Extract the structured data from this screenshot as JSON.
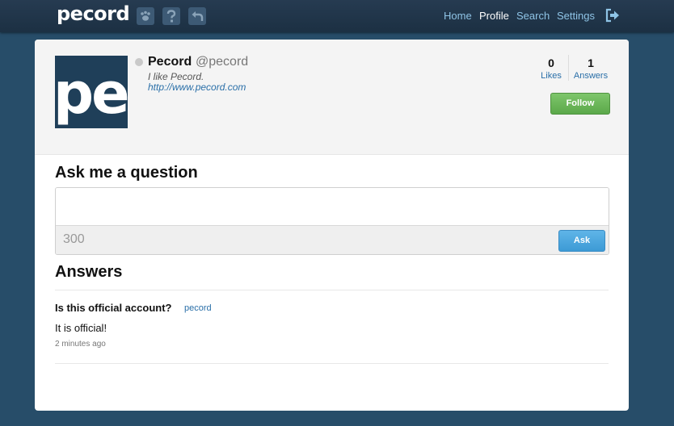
{
  "header": {
    "logo": "pecord",
    "icons": [
      "paw-icon",
      "question-icon",
      "undo-icon"
    ],
    "nav": {
      "home": "Home",
      "profile": "Profile",
      "search": "Search",
      "settings": "Settings"
    },
    "logout_icon": "logout-icon",
    "active_nav": "Profile"
  },
  "profile": {
    "avatar_text": "pe",
    "display_name": "Pecord",
    "handle": "@pecord",
    "bio": "I like Pecord.",
    "website": "http://www.pecord.com",
    "stats": {
      "likes_count": "0",
      "likes_label": "Likes",
      "answers_count": "1",
      "answers_label": "Answers"
    },
    "follow_label": "Follow"
  },
  "ask": {
    "title": "Ask me a question",
    "input_value": "",
    "char_count": "300",
    "ask_label": "Ask"
  },
  "answers": {
    "title": "Answers",
    "items": [
      {
        "question": "Is this official account?",
        "asker": "pecord",
        "answer": "It is official!",
        "time": "2 minutes ago"
      }
    ]
  },
  "colors": {
    "page_background": "#274d69",
    "topbar": "#1f3447",
    "nav_link": "#8fc4e6",
    "link": "#2a6fa8",
    "follow_button": "#6ab85a",
    "ask_button": "#4aa6df"
  }
}
